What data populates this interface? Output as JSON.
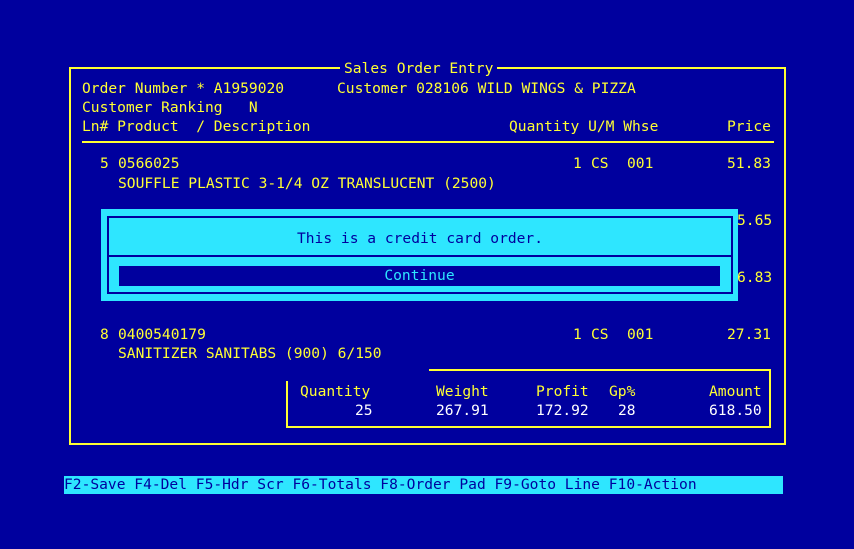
{
  "window": {
    "title": "Sales Order Entry"
  },
  "header": {
    "order_number": "Order Number * A1959020",
    "customer": "Customer 028106 WILD WINGS & PIZZA",
    "customer_ranking": "Customer Ranking   N"
  },
  "columns": {
    "ln_product_desc": "Ln# Product  / Description",
    "qty_um_whse": "Quantity U/M Whse",
    "price": "Price"
  },
  "lines": [
    {
      "ln": "5",
      "product": "0566025",
      "desc": "SOUFFLE PLASTIC 3-1/4 OZ TRANSLUCENT (2500)",
      "qty": "1",
      "um": "CS",
      "whse": "001",
      "price": "51.83"
    },
    {
      "price_partial": "5.65"
    },
    {
      "price_partial": "6.83"
    },
    {
      "ln": "8",
      "product": "0400540179",
      "desc": "SANITIZER SANITABS (900) 6/150",
      "qty": "1",
      "um": "CS",
      "whse": "001",
      "price": "27.31"
    }
  ],
  "totals": {
    "quantity_label": "Quantity",
    "quantity": "25",
    "weight_label": "Weight",
    "weight": "267.91",
    "profit_label": "Profit",
    "profit": "172.92",
    "gp_label": "Gp%",
    "gp": "28",
    "amount_label": "Amount",
    "amount": "618.50"
  },
  "modal": {
    "message": "This is a credit card order.",
    "continue_label": "Continue"
  },
  "keybar": {
    "text": "F2-Save F4-Del F5-Hdr Scr F6-Totals F8-Order Pad F9-Goto Line F10-Action"
  },
  "colors": {
    "background": "#00009e",
    "text": "#ffff33",
    "modal": "#2ee6ff",
    "white": "#ffffff"
  }
}
